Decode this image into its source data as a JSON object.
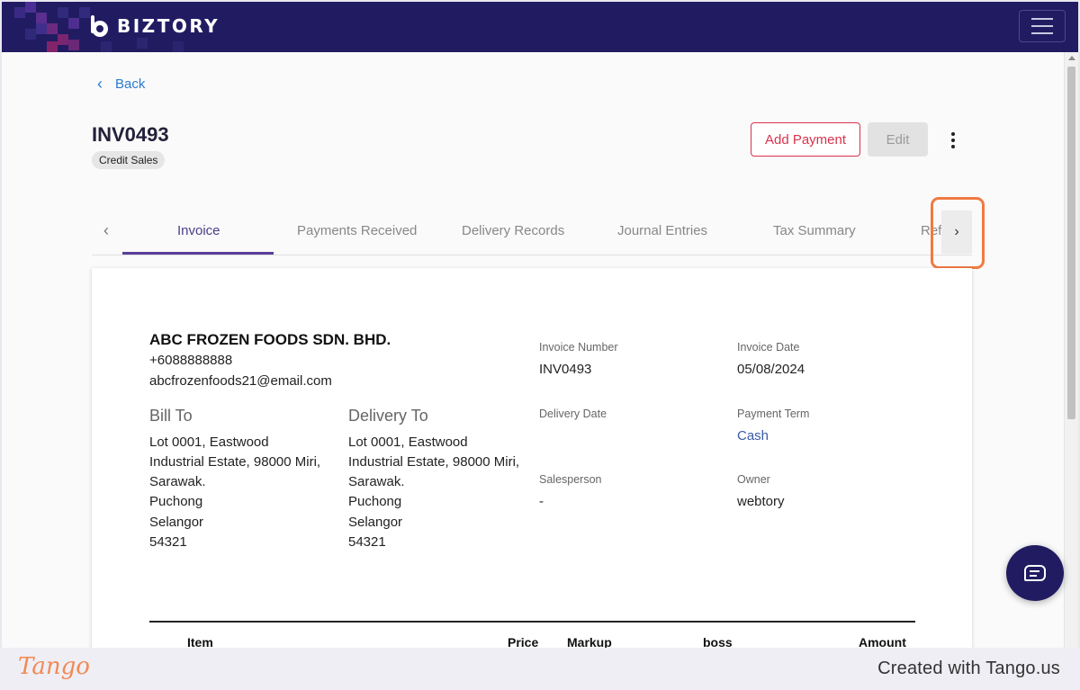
{
  "navbar": {
    "brand": "BIZTORY"
  },
  "back": {
    "label": "Back"
  },
  "header": {
    "title": "INV0493",
    "badge": "Credit Sales",
    "add_payment": "Add Payment",
    "edit": "Edit"
  },
  "tabs": {
    "items": [
      "Invoice",
      "Payments Received",
      "Delivery Records",
      "Journal Entries",
      "Tax Summary",
      "Ref"
    ],
    "active": "Invoice"
  },
  "invoice": {
    "company": "ABC FROZEN FOODS SDN. BHD.",
    "phone": "+6088888888",
    "email": "abcfrozenfoods21@email.com",
    "bill_to": {
      "heading": "Bill To",
      "lines": [
        "Lot 0001, Eastwood",
        "Industrial Estate, 98000 Miri,",
        "Sarawak.",
        "Puchong",
        "Selangor",
        "54321"
      ]
    },
    "delivery_to": {
      "heading": "Delivery To",
      "lines": [
        "Lot 0001, Eastwood",
        "Industrial Estate, 98000 Miri,",
        "Sarawak.",
        "Puchong",
        "Selangor",
        "54321"
      ]
    },
    "meta": {
      "invoice_number_label": "Invoice Number",
      "invoice_number": "INV0493",
      "invoice_date_label": "Invoice Date",
      "invoice_date": "05/08/2024",
      "delivery_date_label": "Delivery Date",
      "delivery_date": "",
      "payment_term_label": "Payment Term",
      "payment_term": "Cash",
      "salesperson_label": "Salesperson",
      "salesperson": "-",
      "owner_label": "Owner",
      "owner": "webtory"
    },
    "table_headers": [
      "Item",
      "Price",
      "Markup",
      "boss",
      "Amount"
    ]
  },
  "footer": {
    "logo": "Tango",
    "created": "Created with Tango.us"
  },
  "colors": {
    "navbar": "#211c62",
    "accent_red": "#d9334c",
    "link_blue": "#2a7bd0",
    "tab_indicator": "#5b3f9a",
    "highlight": "#f07a43"
  }
}
